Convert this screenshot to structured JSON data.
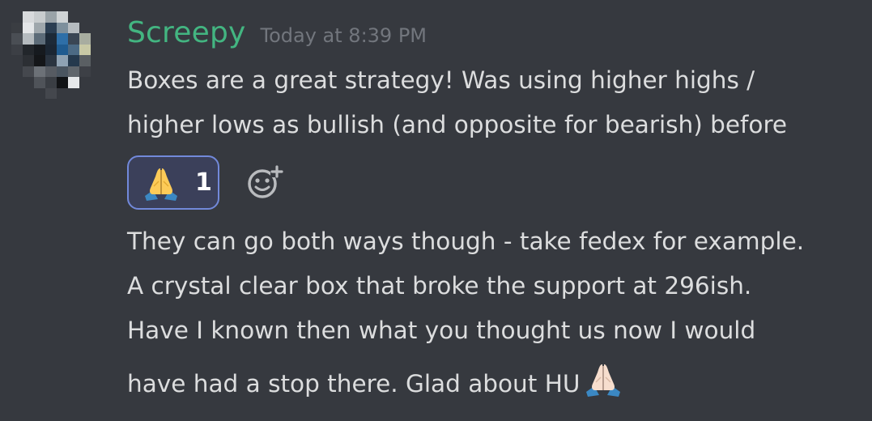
{
  "message": {
    "author": "Screepy",
    "timestamp": "Today at 8:39 PM",
    "first_message_lines": [
      "Boxes are a great strategy! Was using higher highs /",
      "higher lows as bullish (and opposite for bearish) before"
    ],
    "reaction": {
      "emoji": "folded-hands-icon",
      "count": "1"
    },
    "second_message_lines": [
      "They can go both ways though - take fedex for example.",
      "A crystal clear box that broke the support at 296ish.",
      "Have I known then what you thought us now I would",
      "have had a stop there. Glad about HU"
    ],
    "trailing_emoji": "folded-hands-light-icon"
  },
  "colors": {
    "background": "#36393f",
    "username": "#43b581",
    "timestamp": "#72767d",
    "text": "#dcddde",
    "reaction_border": "#7289da",
    "reaction_bg": "#3b405a"
  }
}
